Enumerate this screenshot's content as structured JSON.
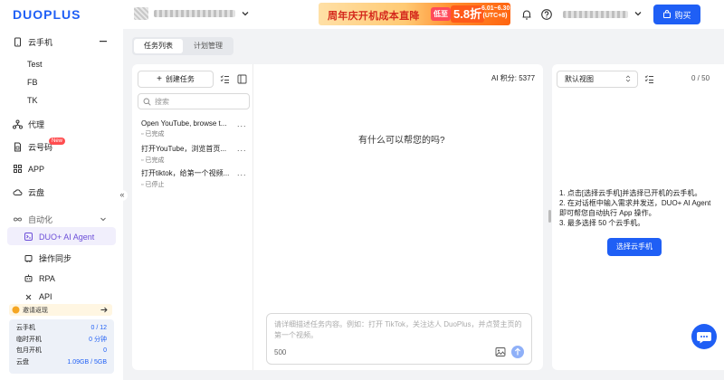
{
  "brand": {
    "logo_text": "DUOPLUS"
  },
  "topbar": {
    "banner": {
      "text": "周年庆开机成本直降",
      "tag": "低至",
      "value": "5.8折",
      "date_range": "6.01~6.30",
      "date_tz": "(UTC+8)"
    },
    "buy_label": "购买"
  },
  "sidebar": {
    "cloud_phone": "云手机",
    "groups": [
      "Test",
      "FB",
      "TK"
    ],
    "proxy": "代理",
    "cloud_number": "云号码",
    "new_badge": "New",
    "app": "APP",
    "cloud_disk": "云盘",
    "automation": "自动化",
    "ai_agent": "DUO+ AI Agent",
    "op_sync": "操作同步",
    "rpa": "RPA",
    "api": "API",
    "promo": "邀请返现",
    "stats": [
      {
        "label": "云手机",
        "value": "0 / 12"
      },
      {
        "label": "临时开机",
        "value": "0 分钟"
      },
      {
        "label": "包月开机",
        "value": "0"
      },
      {
        "label": "云盘",
        "value": "1.09GB / 5GB"
      }
    ],
    "collapse_glyph": "«"
  },
  "tabs": [
    {
      "label": "任务列表",
      "active": true
    },
    {
      "label": "计划管理",
      "active": false
    }
  ],
  "tasks_panel": {
    "create_label": "创建任务",
    "search_placeholder": "搜索",
    "items": [
      {
        "title": "Open YouTube, browse t...",
        "status": "已完成"
      },
      {
        "title": "打开YouTube，浏览首页...",
        "status": "已完成"
      },
      {
        "title": "打开tiktok，给第一个视频...",
        "status": "已停止"
      }
    ],
    "more_glyph": "..."
  },
  "chat": {
    "points": "AI 积分: 5377",
    "question": "有什么可以帮您的吗?",
    "placeholder": "请详细描述任务内容。例如：打开 TikTok，关注达人 DuoPlus，并点赞主页的第一个视频。",
    "char_limit": "500"
  },
  "right_panel": {
    "view": "默认视图",
    "count": "0 / 50",
    "instructions": [
      "1. 点击[选择云手机]并选择已开机的云手机。",
      "2. 在对话框中输入需求并发送，DUO+ AI Agent 即可帮您自动执行 App 操作。",
      "3. 最多选择 50 个云手机。"
    ],
    "select_button": "选择云手机"
  },
  "colors": {
    "accent": "#1f5ff5",
    "badge_red": "#ff4d4f",
    "ai_bg": "#f1effc"
  }
}
